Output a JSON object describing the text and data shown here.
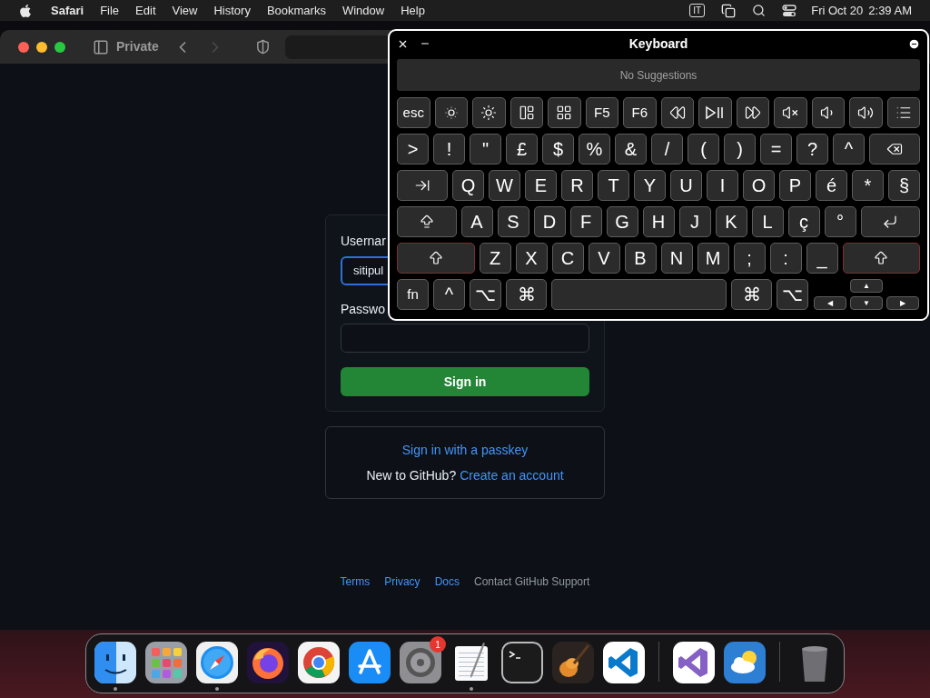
{
  "menu_bar": {
    "app_name": "Safari",
    "menus": [
      "File",
      "Edit",
      "View",
      "History",
      "Bookmarks",
      "Window",
      "Help"
    ],
    "input_source": "IT",
    "date": "Fri Oct 20",
    "time": "2:39 AM"
  },
  "browser": {
    "private_label": "Private",
    "back_disabled": false,
    "forward_disabled": true
  },
  "login": {
    "username_label": "Usernar",
    "username_value": "sitipul",
    "username_focused": true,
    "password_label": "Passwo",
    "sign_in_button": "Sign in",
    "passkey_link": "Sign in with a passkey",
    "new_prompt": "New to GitHub?",
    "create_link": "Create an account"
  },
  "footer_links": [
    {
      "label": "Terms",
      "kind": "link"
    },
    {
      "label": "Privacy",
      "kind": "link"
    },
    {
      "label": "Docs",
      "kind": "link"
    },
    {
      "label": "Contact GitHub Support",
      "kind": "text"
    }
  ],
  "keyboard": {
    "title": "Keyboard",
    "suggestions": "No Suggestions",
    "rows": [
      [
        {
          "kind": "text",
          "label": "esc"
        },
        {
          "kind": "brightness-down"
        },
        {
          "kind": "brightness-up"
        },
        {
          "kind": "mission-control"
        },
        {
          "kind": "launchpad"
        },
        {
          "kind": "text",
          "label": "F5"
        },
        {
          "kind": "text",
          "label": "F6"
        },
        {
          "kind": "rewind"
        },
        {
          "kind": "play-pause"
        },
        {
          "kind": "fast-forward"
        },
        {
          "kind": "mute"
        },
        {
          "kind": "volume-down"
        },
        {
          "kind": "volume-up"
        },
        {
          "kind": "list"
        }
      ],
      [
        {
          "kind": "text",
          "label": ">"
        },
        {
          "kind": "text",
          "label": "!"
        },
        {
          "kind": "text",
          "label": "\""
        },
        {
          "kind": "text",
          "label": "£"
        },
        {
          "kind": "text",
          "label": "$"
        },
        {
          "kind": "text",
          "label": "%"
        },
        {
          "kind": "text",
          "label": "&"
        },
        {
          "kind": "text",
          "label": "/"
        },
        {
          "kind": "text",
          "label": "("
        },
        {
          "kind": "text",
          "label": ")"
        },
        {
          "kind": "text",
          "label": "="
        },
        {
          "kind": "text",
          "label": "?"
        },
        {
          "kind": "text",
          "label": "^"
        },
        {
          "kind": "delete"
        }
      ],
      [
        {
          "kind": "tab"
        },
        {
          "kind": "text",
          "label": "Q"
        },
        {
          "kind": "text",
          "label": "W"
        },
        {
          "kind": "text",
          "label": "E"
        },
        {
          "kind": "text",
          "label": "R"
        },
        {
          "kind": "text",
          "label": "T"
        },
        {
          "kind": "text",
          "label": "Y"
        },
        {
          "kind": "text",
          "label": "U"
        },
        {
          "kind": "text",
          "label": "I"
        },
        {
          "kind": "text",
          "label": "O"
        },
        {
          "kind": "text",
          "label": "P"
        },
        {
          "kind": "text",
          "label": "é"
        },
        {
          "kind": "text",
          "label": "*"
        },
        {
          "kind": "text",
          "label": "§"
        }
      ],
      [
        {
          "kind": "caps"
        },
        {
          "kind": "text",
          "label": "A"
        },
        {
          "kind": "text",
          "label": "S"
        },
        {
          "kind": "text",
          "label": "D"
        },
        {
          "kind": "text",
          "label": "F"
        },
        {
          "kind": "text",
          "label": "G"
        },
        {
          "kind": "text",
          "label": "H"
        },
        {
          "kind": "text",
          "label": "J"
        },
        {
          "kind": "text",
          "label": "K"
        },
        {
          "kind": "text",
          "label": "L"
        },
        {
          "kind": "text",
          "label": "ç"
        },
        {
          "kind": "text",
          "label": "°"
        },
        {
          "kind": "return"
        }
      ],
      [
        {
          "kind": "shift",
          "highlighted": true
        },
        {
          "kind": "text",
          "label": "Z",
          "highlighted": false
        },
        {
          "kind": "text",
          "label": "X",
          "highlighted": false
        },
        {
          "kind": "text",
          "label": "C",
          "highlighted": false
        },
        {
          "kind": "text",
          "label": "V",
          "highlighted": false
        },
        {
          "kind": "text",
          "label": "B",
          "highlighted": false
        },
        {
          "kind": "text",
          "label": "N",
          "highlighted": false
        },
        {
          "kind": "text",
          "label": "M",
          "highlighted": false
        },
        {
          "kind": "text",
          "label": ";",
          "highlighted": false
        },
        {
          "kind": "text",
          "label": ":",
          "highlighted": false
        },
        {
          "kind": "text",
          "label": "_",
          "highlighted": false
        },
        {
          "kind": "shift",
          "highlighted": true
        }
      ],
      [
        {
          "kind": "text",
          "label": "fn"
        },
        {
          "kind": "text",
          "label": "^"
        },
        {
          "kind": "text",
          "label": "⌥"
        },
        {
          "kind": "modifier",
          "label": "⌘"
        },
        {
          "kind": "space"
        },
        {
          "kind": "modifier",
          "label": "⌘"
        },
        {
          "kind": "text",
          "label": "⌥"
        }
      ]
    ],
    "arrow_keys": [
      "▲",
      "◀",
      "▼",
      "▶"
    ]
  },
  "dock": {
    "items": [
      {
        "kind": "finder",
        "running": true
      },
      {
        "kind": "launchpad",
        "running": false
      },
      {
        "kind": "safari",
        "running": true
      },
      {
        "kind": "firefox",
        "running": false
      },
      {
        "kind": "chrome",
        "running": false
      },
      {
        "kind": "appstore",
        "running": false
      },
      {
        "kind": "settings",
        "running": false,
        "badge": "1"
      },
      {
        "kind": "textedit",
        "running": true
      },
      {
        "kind": "terminal",
        "running": false
      },
      {
        "kind": "garageband",
        "running": false
      },
      {
        "kind": "vscode",
        "running": false
      },
      {
        "kind": "separator"
      },
      {
        "kind": "visualstudio",
        "running": false
      },
      {
        "kind": "weather",
        "running": false
      },
      {
        "kind": "separator"
      },
      {
        "kind": "trash",
        "running": false
      }
    ]
  }
}
